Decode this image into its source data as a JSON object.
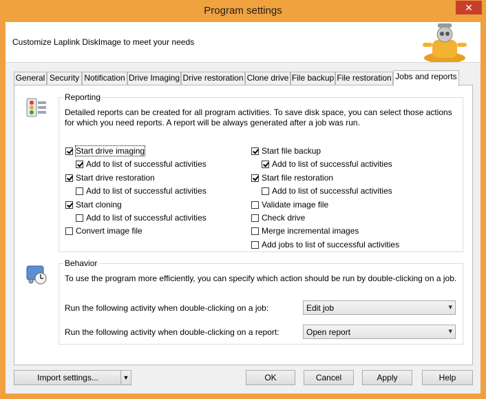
{
  "window": {
    "title": "Program settings",
    "close_label": "✕"
  },
  "banner": {
    "text": "Customize Laplink DiskImage to meet your needs"
  },
  "tabs": [
    {
      "label": "General"
    },
    {
      "label": "Security"
    },
    {
      "label": "Notification"
    },
    {
      "label": "Drive Imaging"
    },
    {
      "label": "Drive restoration"
    },
    {
      "label": "Clone drive"
    },
    {
      "label": "File backup"
    },
    {
      "label": "File restoration"
    },
    {
      "label": "Jobs and reports"
    }
  ],
  "active_tab": "Jobs and reports",
  "reporting": {
    "title": "Reporting",
    "description": "Detailed reports can be created for all program activities. To save disk space, you can select those actions for which you need reports. A report will be always generated after a job was run.",
    "left": [
      {
        "label": "Start drive imaging",
        "checked": true
      },
      {
        "label": "Add to list of successful activities",
        "checked": true
      },
      {
        "label": "Start drive restoration",
        "checked": true
      },
      {
        "label": "Add to list of successful activities",
        "checked": false
      },
      {
        "label": "Start cloning",
        "checked": true
      },
      {
        "label": "Add to list of successful activities",
        "checked": false
      },
      {
        "label": "Convert image file",
        "checked": false
      }
    ],
    "right": [
      {
        "label": "Start file backup",
        "checked": true
      },
      {
        "label": "Add to list of successful activities",
        "checked": true
      },
      {
        "label": "Start file restoration",
        "checked": true
      },
      {
        "label": "Add to list of successful activities",
        "checked": false
      },
      {
        "label": "Validate image file",
        "checked": false
      },
      {
        "label": "Check drive",
        "checked": false
      },
      {
        "label": "Merge incremental images",
        "checked": false
      },
      {
        "label": "Add jobs to list of successful activities",
        "checked": false
      }
    ]
  },
  "behavior": {
    "title": "Behavior",
    "description": "To use the program more efficiently, you can specify which action should be run by double-clicking on a job.",
    "job_label": "Run the following activity when double-clicking on a job:",
    "job_value": "Edit job",
    "report_label": "Run the following activity when double-clicking on a report:",
    "report_value": "Open report"
  },
  "buttons": {
    "import": "Import settings...",
    "ok": "OK",
    "cancel": "Cancel",
    "apply": "Apply",
    "help": "Help"
  }
}
